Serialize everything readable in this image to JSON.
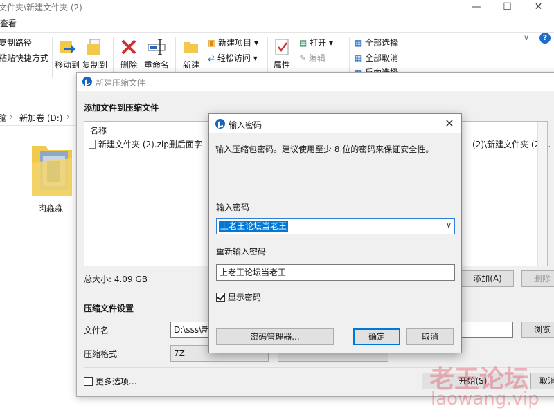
{
  "explorer": {
    "title": "文件夹\\新建文件夹 (2)",
    "tab": "查看",
    "ribbon": {
      "copy_path": "复制路径",
      "paste_shortcut": "粘贴快捷方式",
      "move_to": "移动到",
      "copy_to": "复制到",
      "delete": "删除",
      "rename": "重命名",
      "new_folder": "新建",
      "new_item": "新建项目",
      "easy_access": "轻松访问",
      "properties": "属性",
      "open": "打开",
      "edit": "编辑",
      "select_all": "全部选择",
      "select_none": "全部取消",
      "invert_selection": "反向选择"
    },
    "address": {
      "crumb1": "脑",
      "crumb2": "新加卷 (D:)"
    },
    "folder_name": "肉淼淼",
    "colors": {
      "folder": "#f2c94c",
      "delete_red": "#d32f2f",
      "accent": "#1e6bc9"
    }
  },
  "compress_dialog": {
    "title": "新建压缩文件",
    "section_add": "添加文件到压缩文件",
    "list_header": "名称",
    "file_name": "新建文件夹 (2).zip删后面字",
    "path_tail": "(2)\\新建文件夹 (2)...",
    "total_size": "总大小: 4.09 GB",
    "add_button": "添加(A)",
    "delete_button": "删除",
    "section_settings": "压缩文件设置",
    "filename_label": "文件名",
    "filename_value": "D:\\sss\\新",
    "browse_button": "浏览",
    "format_label": "压缩格式",
    "format_value": "7Z",
    "more_options": "更多选项...",
    "start_button": "开始(S)",
    "cancel_button": "取消"
  },
  "password_dialog": {
    "title": "输入密码",
    "description": "输入压缩包密码。建议使用至少 8 位的密码来保证安全性。",
    "label_password": "输入密码",
    "password_value": "上老王论坛当老王",
    "label_repeat": "重新输入密码",
    "repeat_value": "上老王论坛当老王",
    "show_password": "显示密码",
    "show_password_checked": true,
    "manager_button": "密码管理器...",
    "ok_button": "确定",
    "cancel_button": "取消"
  },
  "watermark": {
    "line1": "老王论坛",
    "line2": "laowang.vip"
  }
}
